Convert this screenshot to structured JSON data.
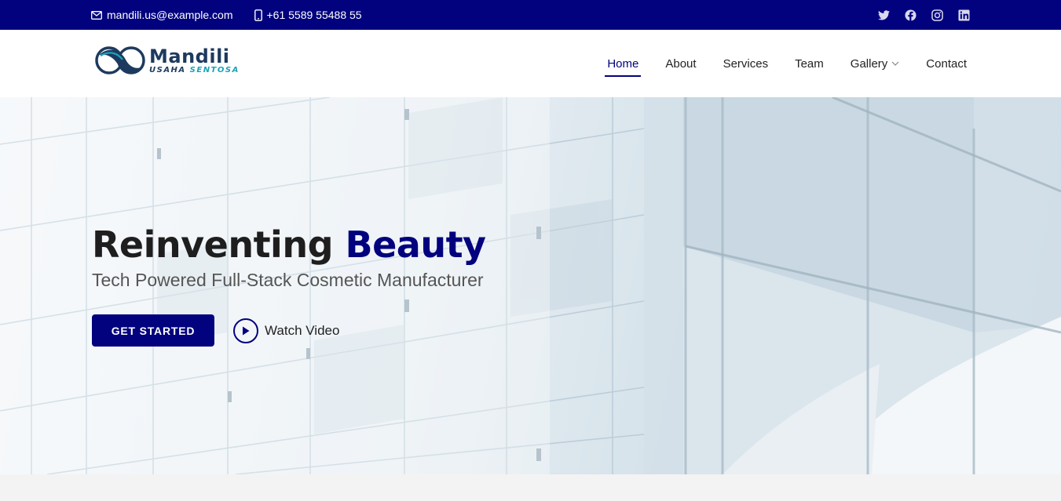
{
  "topbar": {
    "email": "mandili.us@example.com",
    "phone": "+61 5589 55488 55",
    "social_icons": [
      "twitter-icon",
      "facebook-icon",
      "instagram-icon",
      "linkedin-icon"
    ]
  },
  "brand": {
    "name": "Mandili",
    "tagline_part1": "USAHA",
    "tagline_part2": "SENTOSA"
  },
  "nav": {
    "items": [
      {
        "label": "Home",
        "active": true
      },
      {
        "label": "About"
      },
      {
        "label": "Services"
      },
      {
        "label": "Team"
      },
      {
        "label": "Gallery",
        "has_dropdown": true
      },
      {
        "label": "Contact"
      }
    ]
  },
  "hero": {
    "title_part1": "Reinventing",
    "title_part2": "Beauty",
    "subtitle": "Tech Powered Full-Stack Cosmetic Manufacturer",
    "cta_primary": "GET STARTED",
    "cta_secondary": "Watch Video"
  },
  "colors": {
    "primary": "#02027e",
    "topbar_bg": "#02027e",
    "text_dark": "#1e1e1e",
    "brand_teal": "#1aa3b8"
  }
}
